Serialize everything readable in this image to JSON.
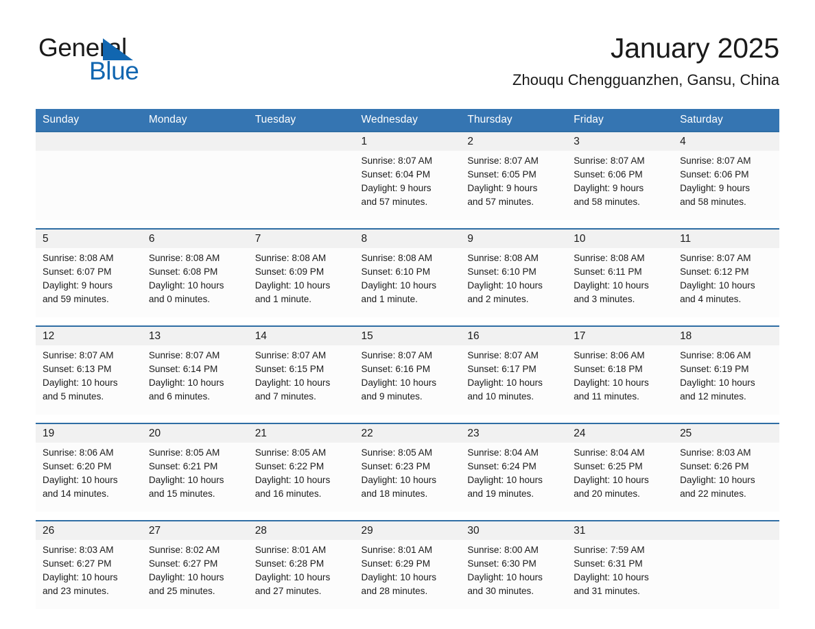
{
  "brand": {
    "name_part1": "General",
    "name_part2": "Blue",
    "triangle_color": "#1166b0"
  },
  "header": {
    "month_title": "January 2025",
    "location": "Zhouqu Chengguanzhen, Gansu, China"
  },
  "theme": {
    "header_blue": "#3575b2",
    "rule_blue": "#2e6da4",
    "daynum_band": "#f1f1f1",
    "cell_background": "#fcfcfc"
  },
  "weekday_headers": [
    "Sunday",
    "Monday",
    "Tuesday",
    "Wednesday",
    "Thursday",
    "Friday",
    "Saturday"
  ],
  "weeks": [
    {
      "days": [
        {
          "num": "",
          "sunrise": "",
          "sunset": "",
          "daylight_1": "",
          "daylight_2": ""
        },
        {
          "num": "",
          "sunrise": "",
          "sunset": "",
          "daylight_1": "",
          "daylight_2": ""
        },
        {
          "num": "",
          "sunrise": "",
          "sunset": "",
          "daylight_1": "",
          "daylight_2": ""
        },
        {
          "num": "1",
          "sunrise": "Sunrise: 8:07 AM",
          "sunset": "Sunset: 6:04 PM",
          "daylight_1": "Daylight: 9 hours",
          "daylight_2": "and 57 minutes."
        },
        {
          "num": "2",
          "sunrise": "Sunrise: 8:07 AM",
          "sunset": "Sunset: 6:05 PM",
          "daylight_1": "Daylight: 9 hours",
          "daylight_2": "and 57 minutes."
        },
        {
          "num": "3",
          "sunrise": "Sunrise: 8:07 AM",
          "sunset": "Sunset: 6:06 PM",
          "daylight_1": "Daylight: 9 hours",
          "daylight_2": "and 58 minutes."
        },
        {
          "num": "4",
          "sunrise": "Sunrise: 8:07 AM",
          "sunset": "Sunset: 6:06 PM",
          "daylight_1": "Daylight: 9 hours",
          "daylight_2": "and 58 minutes."
        }
      ]
    },
    {
      "days": [
        {
          "num": "5",
          "sunrise": "Sunrise: 8:08 AM",
          "sunset": "Sunset: 6:07 PM",
          "daylight_1": "Daylight: 9 hours",
          "daylight_2": "and 59 minutes."
        },
        {
          "num": "6",
          "sunrise": "Sunrise: 8:08 AM",
          "sunset": "Sunset: 6:08 PM",
          "daylight_1": "Daylight: 10 hours",
          "daylight_2": "and 0 minutes."
        },
        {
          "num": "7",
          "sunrise": "Sunrise: 8:08 AM",
          "sunset": "Sunset: 6:09 PM",
          "daylight_1": "Daylight: 10 hours",
          "daylight_2": "and 1 minute."
        },
        {
          "num": "8",
          "sunrise": "Sunrise: 8:08 AM",
          "sunset": "Sunset: 6:10 PM",
          "daylight_1": "Daylight: 10 hours",
          "daylight_2": "and 1 minute."
        },
        {
          "num": "9",
          "sunrise": "Sunrise: 8:08 AM",
          "sunset": "Sunset: 6:10 PM",
          "daylight_1": "Daylight: 10 hours",
          "daylight_2": "and 2 minutes."
        },
        {
          "num": "10",
          "sunrise": "Sunrise: 8:08 AM",
          "sunset": "Sunset: 6:11 PM",
          "daylight_1": "Daylight: 10 hours",
          "daylight_2": "and 3 minutes."
        },
        {
          "num": "11",
          "sunrise": "Sunrise: 8:07 AM",
          "sunset": "Sunset: 6:12 PM",
          "daylight_1": "Daylight: 10 hours",
          "daylight_2": "and 4 minutes."
        }
      ]
    },
    {
      "days": [
        {
          "num": "12",
          "sunrise": "Sunrise: 8:07 AM",
          "sunset": "Sunset: 6:13 PM",
          "daylight_1": "Daylight: 10 hours",
          "daylight_2": "and 5 minutes."
        },
        {
          "num": "13",
          "sunrise": "Sunrise: 8:07 AM",
          "sunset": "Sunset: 6:14 PM",
          "daylight_1": "Daylight: 10 hours",
          "daylight_2": "and 6 minutes."
        },
        {
          "num": "14",
          "sunrise": "Sunrise: 8:07 AM",
          "sunset": "Sunset: 6:15 PM",
          "daylight_1": "Daylight: 10 hours",
          "daylight_2": "and 7 minutes."
        },
        {
          "num": "15",
          "sunrise": "Sunrise: 8:07 AM",
          "sunset": "Sunset: 6:16 PM",
          "daylight_1": "Daylight: 10 hours",
          "daylight_2": "and 9 minutes."
        },
        {
          "num": "16",
          "sunrise": "Sunrise: 8:07 AM",
          "sunset": "Sunset: 6:17 PM",
          "daylight_1": "Daylight: 10 hours",
          "daylight_2": "and 10 minutes."
        },
        {
          "num": "17",
          "sunrise": "Sunrise: 8:06 AM",
          "sunset": "Sunset: 6:18 PM",
          "daylight_1": "Daylight: 10 hours",
          "daylight_2": "and 11 minutes."
        },
        {
          "num": "18",
          "sunrise": "Sunrise: 8:06 AM",
          "sunset": "Sunset: 6:19 PM",
          "daylight_1": "Daylight: 10 hours",
          "daylight_2": "and 12 minutes."
        }
      ]
    },
    {
      "days": [
        {
          "num": "19",
          "sunrise": "Sunrise: 8:06 AM",
          "sunset": "Sunset: 6:20 PM",
          "daylight_1": "Daylight: 10 hours",
          "daylight_2": "and 14 minutes."
        },
        {
          "num": "20",
          "sunrise": "Sunrise: 8:05 AM",
          "sunset": "Sunset: 6:21 PM",
          "daylight_1": "Daylight: 10 hours",
          "daylight_2": "and 15 minutes."
        },
        {
          "num": "21",
          "sunrise": "Sunrise: 8:05 AM",
          "sunset": "Sunset: 6:22 PM",
          "daylight_1": "Daylight: 10 hours",
          "daylight_2": "and 16 minutes."
        },
        {
          "num": "22",
          "sunrise": "Sunrise: 8:05 AM",
          "sunset": "Sunset: 6:23 PM",
          "daylight_1": "Daylight: 10 hours",
          "daylight_2": "and 18 minutes."
        },
        {
          "num": "23",
          "sunrise": "Sunrise: 8:04 AM",
          "sunset": "Sunset: 6:24 PM",
          "daylight_1": "Daylight: 10 hours",
          "daylight_2": "and 19 minutes."
        },
        {
          "num": "24",
          "sunrise": "Sunrise: 8:04 AM",
          "sunset": "Sunset: 6:25 PM",
          "daylight_1": "Daylight: 10 hours",
          "daylight_2": "and 20 minutes."
        },
        {
          "num": "25",
          "sunrise": "Sunrise: 8:03 AM",
          "sunset": "Sunset: 6:26 PM",
          "daylight_1": "Daylight: 10 hours",
          "daylight_2": "and 22 minutes."
        }
      ]
    },
    {
      "days": [
        {
          "num": "26",
          "sunrise": "Sunrise: 8:03 AM",
          "sunset": "Sunset: 6:27 PM",
          "daylight_1": "Daylight: 10 hours",
          "daylight_2": "and 23 minutes."
        },
        {
          "num": "27",
          "sunrise": "Sunrise: 8:02 AM",
          "sunset": "Sunset: 6:27 PM",
          "daylight_1": "Daylight: 10 hours",
          "daylight_2": "and 25 minutes."
        },
        {
          "num": "28",
          "sunrise": "Sunrise: 8:01 AM",
          "sunset": "Sunset: 6:28 PM",
          "daylight_1": "Daylight: 10 hours",
          "daylight_2": "and 27 minutes."
        },
        {
          "num": "29",
          "sunrise": "Sunrise: 8:01 AM",
          "sunset": "Sunset: 6:29 PM",
          "daylight_1": "Daylight: 10 hours",
          "daylight_2": "and 28 minutes."
        },
        {
          "num": "30",
          "sunrise": "Sunrise: 8:00 AM",
          "sunset": "Sunset: 6:30 PM",
          "daylight_1": "Daylight: 10 hours",
          "daylight_2": "and 30 minutes."
        },
        {
          "num": "31",
          "sunrise": "Sunrise: 7:59 AM",
          "sunset": "Sunset: 6:31 PM",
          "daylight_1": "Daylight: 10 hours",
          "daylight_2": "and 31 minutes."
        },
        {
          "num": "",
          "sunrise": "",
          "sunset": "",
          "daylight_1": "",
          "daylight_2": ""
        }
      ]
    }
  ]
}
